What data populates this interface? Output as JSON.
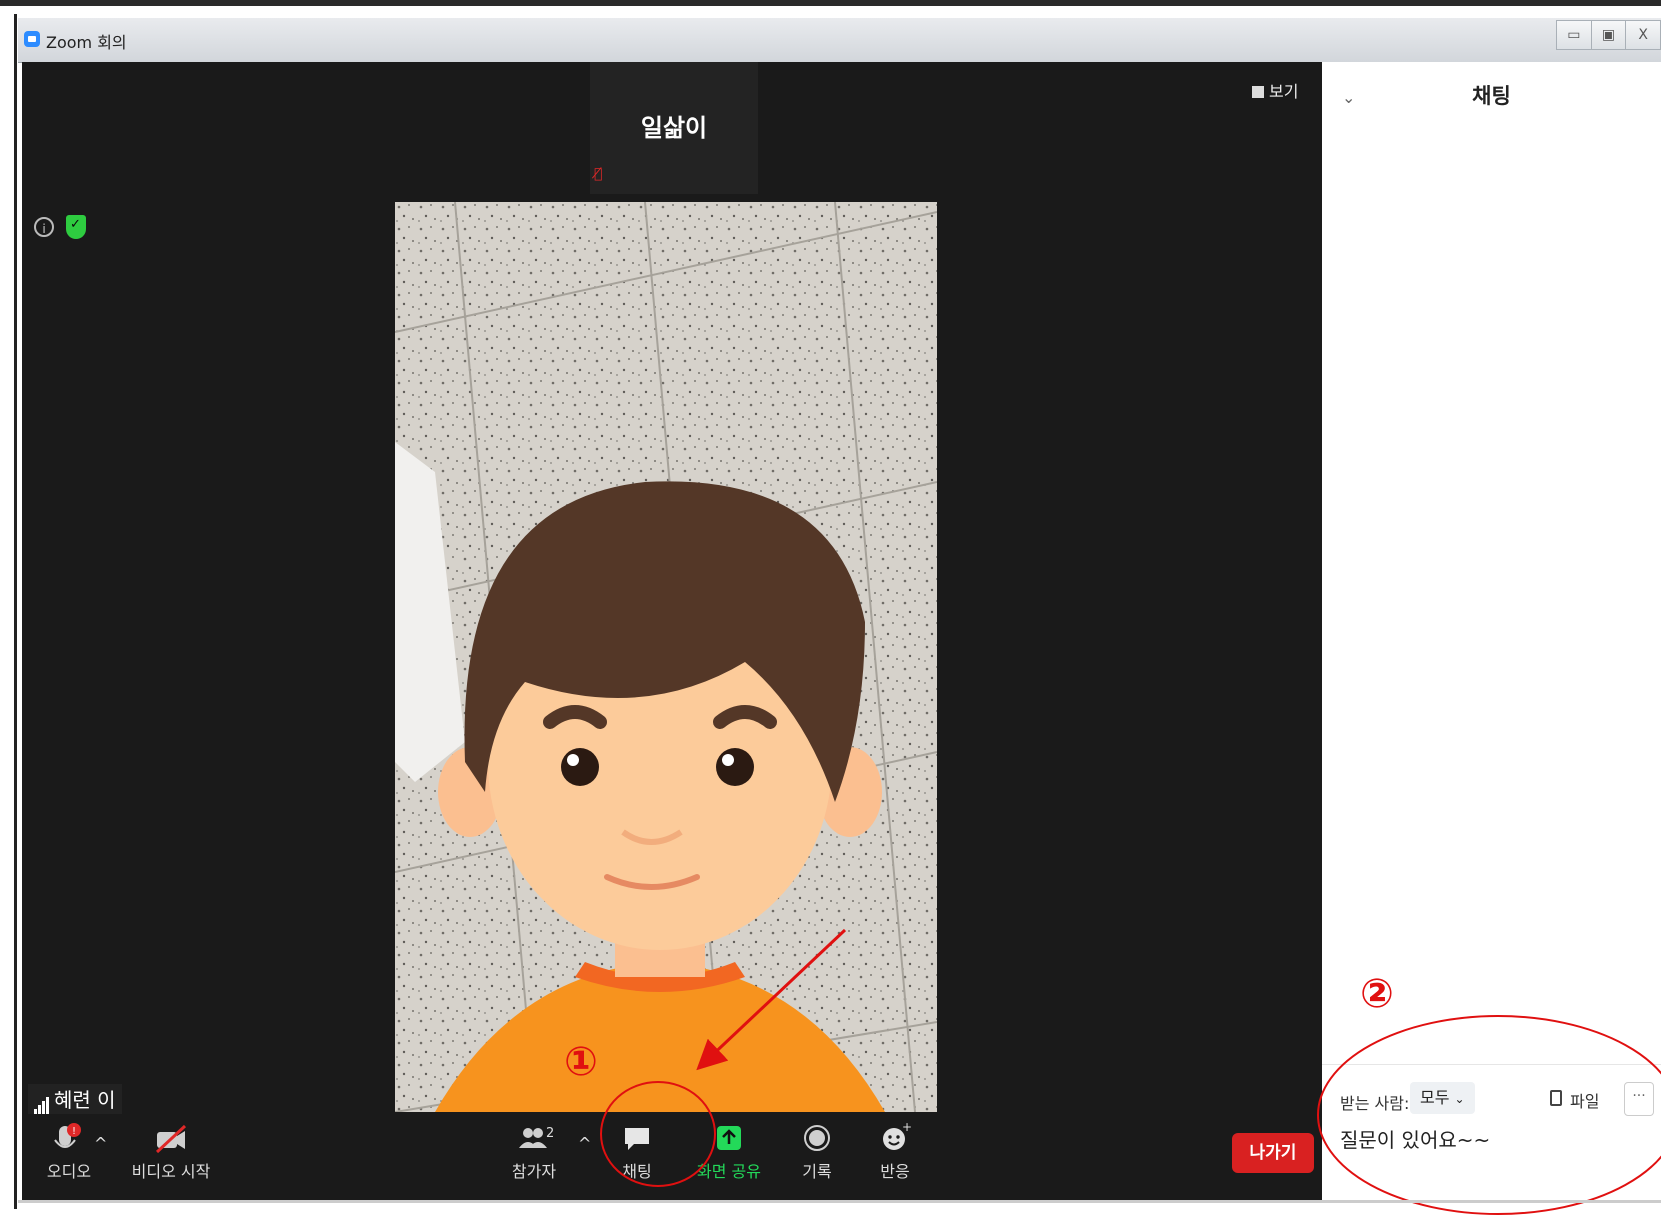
{
  "window": {
    "title": "Zoom 회의",
    "controls": [
      "▭",
      "▣",
      "X"
    ]
  },
  "view_button": {
    "label": "보기"
  },
  "participant_tile": {
    "name": "일삶이"
  },
  "self_name": "혜련 이",
  "toolbar": {
    "audio": "오디오",
    "video": "비디오 시작",
    "participants": "참가자",
    "participant_count": "2",
    "chat": "채팅",
    "share": "화면 공유",
    "record": "기록",
    "reactions": "반응",
    "leave": "나가기"
  },
  "chat_panel": {
    "title": "채팅",
    "to_label": "받는 사람:",
    "to_value": "모두",
    "file_label": "파일",
    "more_label": "···",
    "message": "질문이 있어요~~"
  },
  "annotations": {
    "step1": "①",
    "step2": "②"
  },
  "colors": {
    "share_green": "#23d959",
    "leave_red": "#d92121",
    "annotation_red": "#e01010"
  }
}
